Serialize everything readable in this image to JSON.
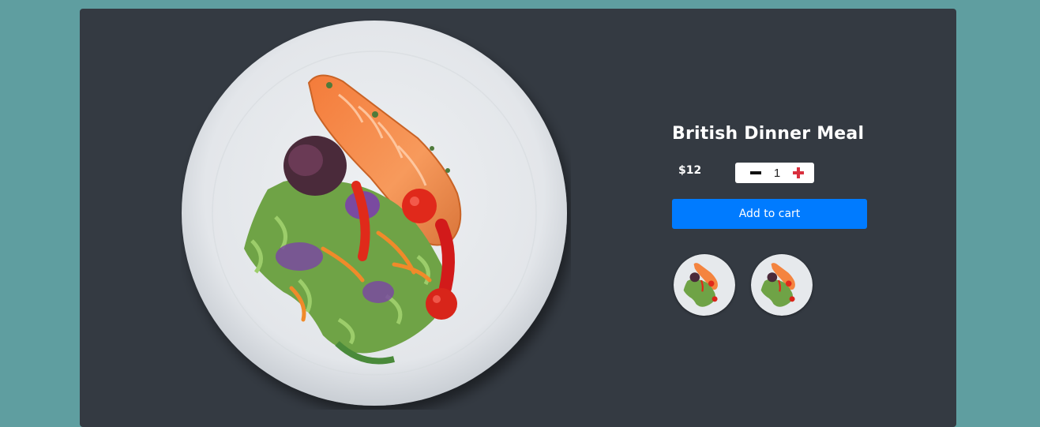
{
  "product": {
    "title": "British Dinner Meal",
    "price": "$12",
    "quantity": "1",
    "add_to_cart_label": "Add to cart",
    "image_alt": "Salmon fillet with mixed salad on a white plate",
    "thumbnails": [
      {
        "alt": "Salmon salad plate thumbnail 1"
      },
      {
        "alt": "Salmon salad plate thumbnail 2"
      }
    ]
  },
  "icons": {
    "decrease": "minus-icon",
    "increase": "plus-icon"
  },
  "colors": {
    "page_background": "#5f9ea0",
    "card_background": "#343a42",
    "add_button": "#007bff",
    "plus_icon": "#d9303e"
  }
}
